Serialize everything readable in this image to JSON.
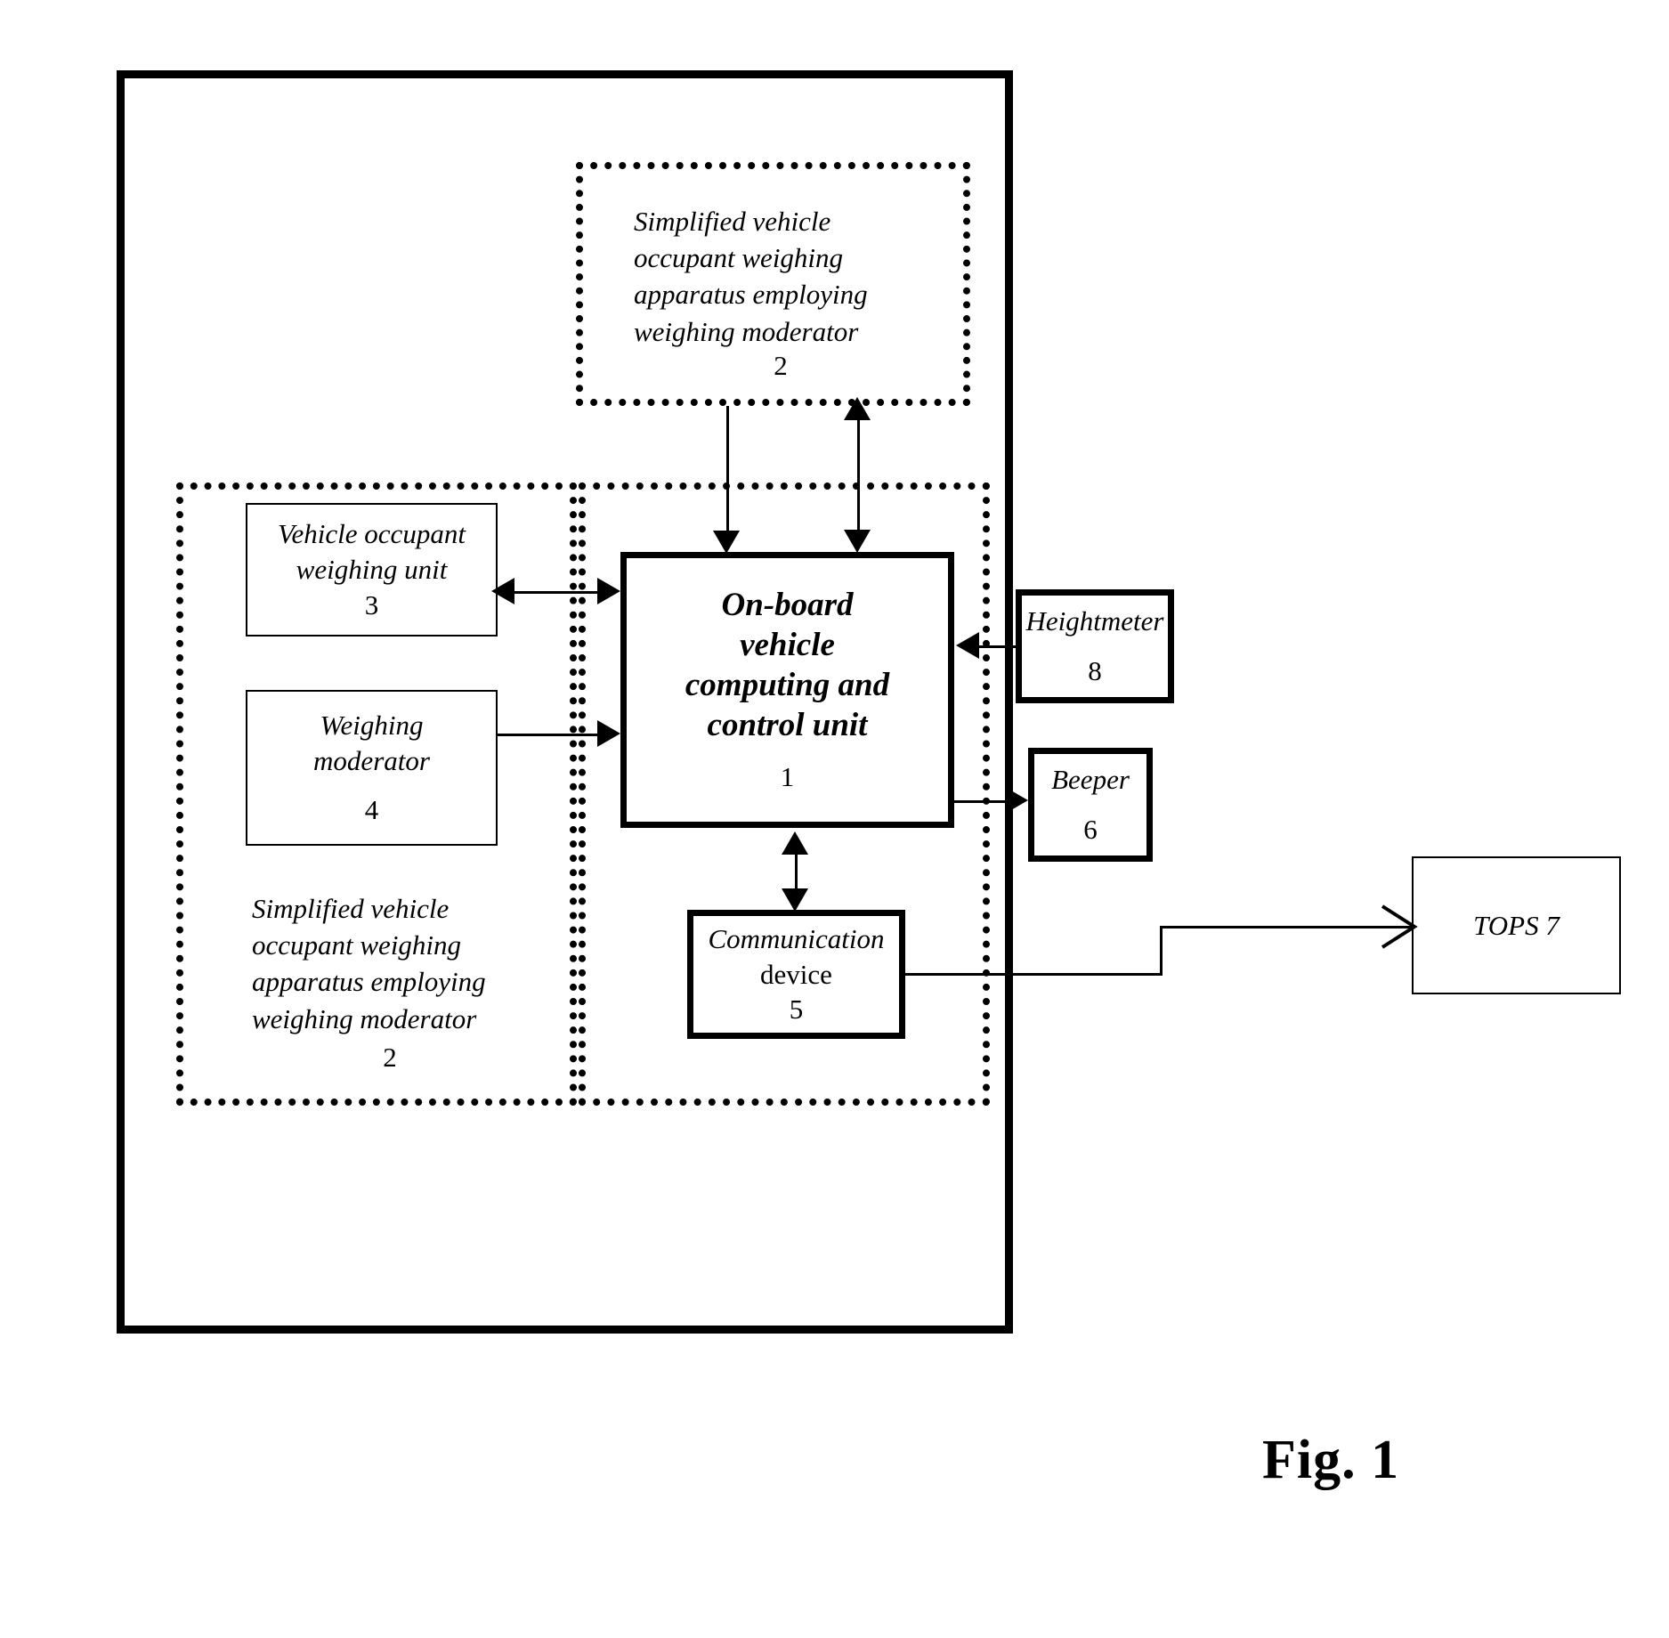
{
  "figure": {
    "caption": "Fig. 1"
  },
  "groups": {
    "top_apparatus": {
      "label": "Simplified vehicle\noccupant  weighing\napparatus employing\nweighing moderator",
      "number": "2"
    },
    "left_apparatus": {
      "label": "Simplified vehicle\noccupant  weighing\napparatus employing\nweighing moderator",
      "number": "2"
    },
    "onboard_group": {
      "label": ""
    }
  },
  "boxes": {
    "weighing_unit": {
      "label": "Vehicle occupant\nweighing unit",
      "number": "3"
    },
    "weighing_moderator": {
      "label": "Weighing\nmoderator",
      "number": "4"
    },
    "control_unit": {
      "label": "On-board\nvehicle\ncomputing and\ncontrol  unit",
      "number": "1"
    },
    "heightmeter": {
      "label": "Heightmeter",
      "number": "8"
    },
    "beeper": {
      "label": "Beeper",
      "number": "6"
    },
    "communication_device": {
      "label_italic": "Communication",
      "label_upright": "device",
      "number": "5"
    },
    "tops": {
      "label": "TOPS  7"
    }
  },
  "connectors": [
    {
      "name": "apparatus2-to-control-unit",
      "type": "arrow-down"
    },
    {
      "name": "control-unit-to-apparatus2",
      "type": "arrow-double-vertical"
    },
    {
      "name": "weighing-unit-to-control-unit",
      "type": "arrow-double-horizontal"
    },
    {
      "name": "weighing-moderator-to-control-unit",
      "type": "arrow-right"
    },
    {
      "name": "heightmeter-to-control-unit",
      "type": "arrow-left"
    },
    {
      "name": "control-unit-to-beeper",
      "type": "arrow-right"
    },
    {
      "name": "control-unit-to-communication-device",
      "type": "arrow-double-vertical"
    },
    {
      "name": "communication-device-to-tops",
      "type": "arrow-right-open"
    }
  ],
  "colors": {
    "ink": "#000000",
    "background": "#ffffff"
  }
}
